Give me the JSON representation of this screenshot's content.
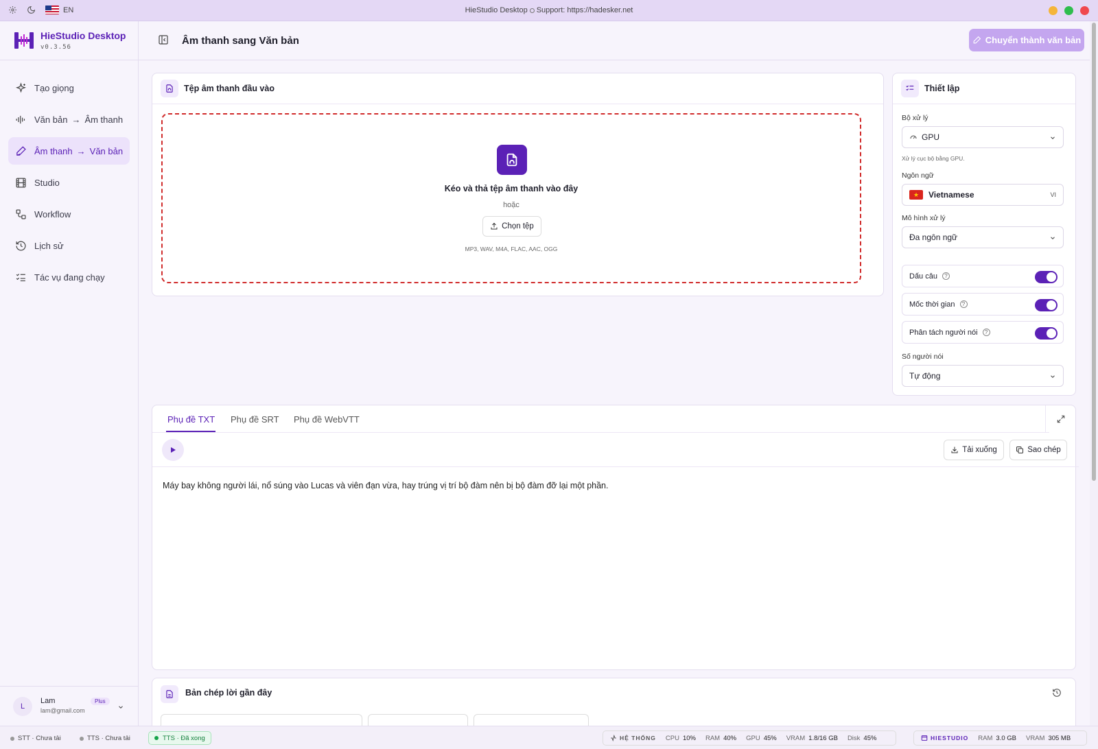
{
  "titlebar": {
    "title": "HieStudio Desktop",
    "support": "Support: https://hadesker.net",
    "lang_code": "EN",
    "controls": {
      "minimize_color": "#f5b53a",
      "maximize_color": "#2fbd4e",
      "close_color": "#f0484e"
    }
  },
  "brand": {
    "name": "HieStudio Desktop",
    "version": "v0.3.56",
    "accent": "#5b21b6"
  },
  "sidebar": {
    "items": [
      {
        "label": "Tạo giọng",
        "icon": "sparkles-icon"
      },
      {
        "label_a": "Văn bản",
        "label_b": "Âm thanh",
        "icon": "waveform-icon"
      },
      {
        "label_a": "Âm thanh",
        "label_b": "Văn bản",
        "icon": "pen-icon",
        "active": true
      },
      {
        "label": "Studio",
        "icon": "film-icon"
      },
      {
        "label": "Workflow",
        "icon": "workflow-icon"
      },
      {
        "label": "Lịch sử",
        "icon": "history-icon"
      },
      {
        "label": "Tác vụ đang chạy",
        "icon": "task-list-icon"
      }
    ]
  },
  "user": {
    "initial": "L",
    "name": "Lam",
    "email": "lam@gmail.com",
    "plan": "Plus"
  },
  "header": {
    "title": "Âm thanh sang Văn bản",
    "action_label": "Chuyển thành văn bản"
  },
  "input_card": {
    "title": "Tệp âm thanh đầu vào",
    "drop_title": "Kéo và thả tệp âm thanh vào đây",
    "or_text": "hoặc",
    "choose_label": "Chọn tệp",
    "formats": "MP3, WAV, M4A, FLAC, AAC, OGG"
  },
  "settings": {
    "title": "Thiết lập",
    "processor_label": "Bộ xử lý",
    "processor_value": "GPU",
    "processor_hint": "Xử lý cục bộ bằng GPU.",
    "language_label": "Ngôn ngữ",
    "language_value": "Vietnamese",
    "language_code": "VI",
    "model_label": "Mô hình xử lý",
    "model_value": "Đa ngôn ngữ",
    "toggles": [
      {
        "label": "Dấu câu",
        "on": true
      },
      {
        "label": "Mốc thời gian",
        "on": true
      },
      {
        "label": "Phân tách người nói",
        "on": true
      }
    ],
    "speakers_label": "Số người nói",
    "speakers_value": "Tự động"
  },
  "output": {
    "tabs": [
      "Phụ đề TXT",
      "Phụ đề SRT",
      "Phụ đề WebVTT"
    ],
    "active_tab": 0,
    "download_label": "Tải xuống",
    "copy_label": "Sao chép",
    "transcript": "Máy bay không người lái, nổ súng vào Lucas và viên đạn vừa, hay trúng vị trí bộ đàm nên bị bộ đàm đỡ lại một phần."
  },
  "recent": {
    "title": "Bản chép lời gần đây"
  },
  "statusbar": {
    "stt": "STT · Chưa tải",
    "tts1": "TTS · Chưa tải",
    "tts2": "TTS · Đã xong",
    "system_label": "HỆ THỐNG",
    "system": [
      {
        "k": "CPU",
        "v": "10%"
      },
      {
        "k": "RAM",
        "v": "40%"
      },
      {
        "k": "GPU",
        "v": "45%"
      },
      {
        "k": "VRAM",
        "v": "1.8/16 GB"
      },
      {
        "k": "Disk",
        "v": "45%"
      }
    ],
    "app_label": "HIESTUDIO",
    "app": [
      {
        "k": "RAM",
        "v": "3.0 GB"
      },
      {
        "k": "VRAM",
        "v": "305 MB"
      }
    ]
  }
}
